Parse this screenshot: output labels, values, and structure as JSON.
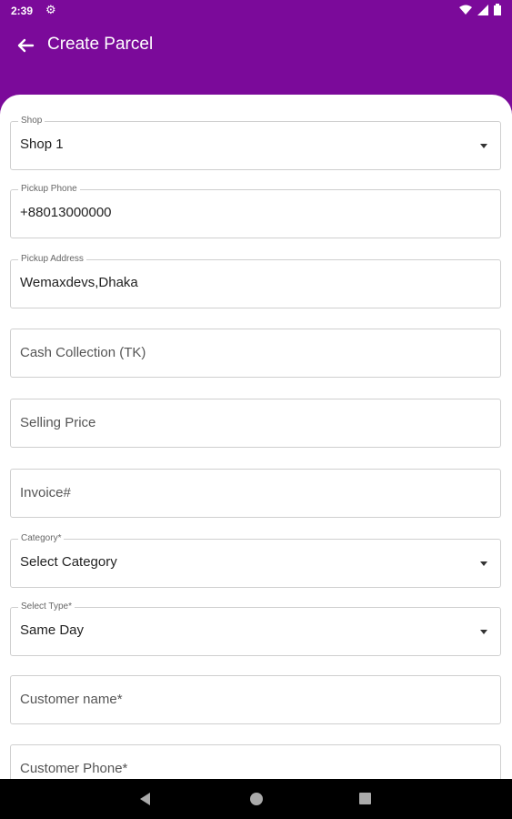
{
  "status_bar": {
    "time": "2:39"
  },
  "app_bar": {
    "title": "Create Parcel"
  },
  "form": {
    "shop": {
      "label": "Shop",
      "value": "Shop 1"
    },
    "pickup_phone": {
      "label": "Pickup Phone",
      "value": "+88013000000"
    },
    "pickup_address": {
      "label": "Pickup Address",
      "value": "Wemaxdevs,Dhaka"
    },
    "cash_collection": {
      "placeholder": "Cash Collection (TK)"
    },
    "selling_price": {
      "placeholder": "Selling Price"
    },
    "invoice": {
      "placeholder": "Invoice#"
    },
    "category": {
      "label": "Category*",
      "value": "Select Category"
    },
    "select_type": {
      "label": "Select Type*",
      "value": "Same Day"
    },
    "customer_name": {
      "placeholder": "Customer name*"
    },
    "customer_phone": {
      "placeholder": "Customer Phone*"
    }
  },
  "colors": {
    "primary": "#7b0a9a",
    "sheet": "#ffffff",
    "nav_bar": "#000000"
  }
}
